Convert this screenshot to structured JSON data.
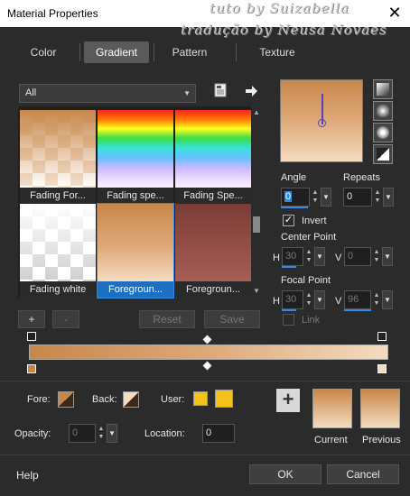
{
  "window": {
    "title": "Material Properties",
    "watermark_line1": "tuto by Suizabella",
    "watermark_line2": "tradução by Neusa Novaes",
    "close_symbol": "✕"
  },
  "tabs": [
    {
      "label": "Color",
      "active": false
    },
    {
      "label": "Gradient",
      "active": true
    },
    {
      "label": "Pattern",
      "active": false
    },
    {
      "label": "Texture",
      "active": false
    }
  ],
  "category": {
    "selected": "All"
  },
  "gradients": [
    {
      "label": "Fading For...",
      "selected": false
    },
    {
      "label": "Fading spe...",
      "selected": false
    },
    {
      "label": "Fading Spe...",
      "selected": false
    },
    {
      "label": "Fading white",
      "selected": false
    },
    {
      "label": "Foregroun...",
      "selected": true
    },
    {
      "label": "Foregroun...",
      "selected": false
    }
  ],
  "grid_buttons": {
    "add": "+",
    "remove": "-",
    "reset": "Reset",
    "save": "Save"
  },
  "angle": {
    "label": "Angle",
    "value": "0"
  },
  "repeats": {
    "label": "Repeats",
    "value": "0"
  },
  "invert": {
    "label": "Invert",
    "checked": true
  },
  "center_point": {
    "label": "Center Point",
    "h_label": "H",
    "h_value": "30",
    "v_label": "V",
    "v_value": "0"
  },
  "focal_point": {
    "label": "Focal Point",
    "h_label": "H",
    "h_value": "30",
    "v_label": "V",
    "v_value": "96"
  },
  "link": {
    "label": "Link",
    "checked": false
  },
  "colors": {
    "gradient_start": "#c8874a",
    "gradient_mid": "#dda979",
    "gradient_end": "#f4dcc0",
    "selection_blue": "#1d6fbf",
    "user_yellow": "#f2c21b"
  },
  "fore": {
    "label": "Fore:"
  },
  "back": {
    "label": "Back:"
  },
  "user": {
    "label": "User:"
  },
  "opacity": {
    "label": "Opacity:",
    "value": "0"
  },
  "location": {
    "label": "Location:",
    "value": "0"
  },
  "current": {
    "label": "Current"
  },
  "previous": {
    "label": "Previous"
  },
  "footer": {
    "help": "Help",
    "ok": "OK",
    "cancel": "Cancel"
  }
}
